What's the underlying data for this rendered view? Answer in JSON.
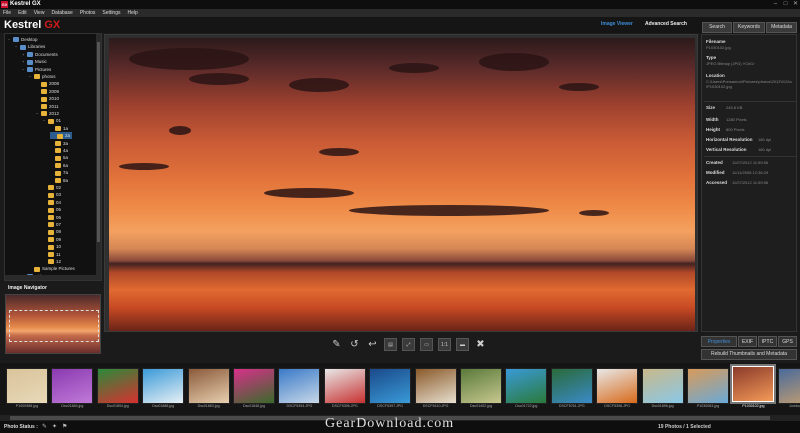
{
  "window": {
    "title": "Kestrel GX",
    "icon": "GX",
    "minimize": "–",
    "maximize": "□",
    "close": "✕"
  },
  "menu": [
    "File",
    "Edit",
    "View",
    "Database",
    "Photos",
    "Settings",
    "Help"
  ],
  "logo": {
    "main": "Kestrel",
    "accent": "GX"
  },
  "view_tabs": {
    "image_viewer": "Image Viewer",
    "advanced_search": "Advanced Search"
  },
  "panel_tabs": [
    "Search",
    "Keywords",
    "Metadata"
  ],
  "tree": [
    {
      "label": "Desktop",
      "level": 0,
      "exp": "−",
      "blue": true
    },
    {
      "label": "Libraries",
      "level": 1,
      "exp": "−",
      "blue": true
    },
    {
      "label": "Documents",
      "level": 2,
      "exp": "+",
      "blue": true
    },
    {
      "label": "Music",
      "level": 2,
      "exp": "+",
      "blue": true
    },
    {
      "label": "Pictures",
      "level": 2,
      "exp": "−",
      "blue": true
    },
    {
      "label": "photos",
      "level": 3,
      "exp": "−"
    },
    {
      "label": "2008",
      "level": 4,
      "exp": ""
    },
    {
      "label": "2009",
      "level": 4,
      "exp": ""
    },
    {
      "label": "2010",
      "level": 4,
      "exp": ""
    },
    {
      "label": "2011",
      "level": 4,
      "exp": ""
    },
    {
      "label": "2012",
      "level": 4,
      "exp": "−"
    },
    {
      "label": "01",
      "level": 5,
      "exp": "−"
    },
    {
      "label": "1a",
      "level": 6,
      "exp": ""
    },
    {
      "label": "2a",
      "level": 6,
      "exp": "",
      "selected": true
    },
    {
      "label": "3a",
      "level": 6,
      "exp": ""
    },
    {
      "label": "4a",
      "level": 6,
      "exp": ""
    },
    {
      "label": "5a",
      "level": 6,
      "exp": ""
    },
    {
      "label": "6a",
      "level": 6,
      "exp": ""
    },
    {
      "label": "7a",
      "level": 6,
      "exp": ""
    },
    {
      "label": "8a",
      "level": 6,
      "exp": ""
    },
    {
      "label": "02",
      "level": 5,
      "exp": ""
    },
    {
      "label": "03",
      "level": 5,
      "exp": ""
    },
    {
      "label": "04",
      "level": 5,
      "exp": ""
    },
    {
      "label": "05",
      "level": 5,
      "exp": ""
    },
    {
      "label": "06",
      "level": 5,
      "exp": ""
    },
    {
      "label": "07",
      "level": 5,
      "exp": ""
    },
    {
      "label": "08",
      "level": 5,
      "exp": ""
    },
    {
      "label": "09",
      "level": 5,
      "exp": ""
    },
    {
      "label": "10",
      "level": 5,
      "exp": ""
    },
    {
      "label": "11",
      "level": 5,
      "exp": ""
    },
    {
      "label": "12",
      "level": 5,
      "exp": ""
    },
    {
      "label": "Sample Pictures",
      "level": 3,
      "exp": ""
    },
    {
      "label": "Videos",
      "level": 2,
      "exp": "+",
      "blue": true
    }
  ],
  "navigator": {
    "label": "Image Navigator"
  },
  "toolbar": [
    {
      "name": "pencil-icon",
      "glyph": "✎"
    },
    {
      "name": "rotate-left-icon",
      "glyph": "↺"
    },
    {
      "name": "undo-icon",
      "glyph": "↩"
    },
    {
      "name": "film-icon",
      "glyph": "▤"
    },
    {
      "name": "fit-window-icon",
      "glyph": "⤢"
    },
    {
      "name": "monitor-icon",
      "glyph": "▭"
    },
    {
      "name": "actual-size-icon",
      "glyph": "1:1"
    },
    {
      "name": "fullscreen-icon",
      "glyph": "▬"
    },
    {
      "name": "delete-icon",
      "glyph": "✖"
    }
  ],
  "properties": {
    "filename_label": "Filename",
    "filename": "P1030102.jpg",
    "type_label": "Type",
    "type": "JPEG Bitmap (JPG) YCbCr",
    "location_label": "Location",
    "location": "C:\\Users\\Ponsamon\\Pictures\\photos\\2012\\01\\2a\\P1030102.jpg",
    "size_label": "Size",
    "size": "245.6 KB",
    "width_label": "Width",
    "width": "1280 Pixels",
    "height_label": "Height",
    "height": "800 Pixels",
    "hres_label": "Horizontal Resolution",
    "hres": "180 dpi",
    "vres_label": "Vertical Resolution",
    "vres": "180 dpi",
    "created_label": "Created",
    "created": "11/07/2012 11:59:56",
    "modified_label": "Modified",
    "modified": "11/11/2008 12:36:29",
    "accessed_label": "Accessed",
    "accessed": "11/07/2012 11:59:56"
  },
  "bottom_tabs": [
    "Properties",
    "EXIF",
    "IPTC",
    "GPS"
  ],
  "rebuild_label": "Rebuild Thumbnails and Metadata",
  "thumbnails": [
    {
      "label": "P1000988.jpg",
      "colors": [
        "#d9c39a",
        "#e8d9b8"
      ]
    },
    {
      "label": "Dsc01884.jpg",
      "colors": [
        "#8a3ab0",
        "#c07ad8"
      ]
    },
    {
      "label": "Dsc01894.jpg",
      "colors": [
        "#2a8a3a",
        "#d83030"
      ]
    },
    {
      "label": "Dsc01888.jpg",
      "colors": [
        "#3a9ad8",
        "#e8f0f4"
      ]
    },
    {
      "label": "Dsc01863.jpg",
      "colors": [
        "#8a5a3a",
        "#e8d0b0"
      ]
    },
    {
      "label": "Dsc01848.jpg",
      "colors": [
        "#d8308a",
        "#3a6a2a"
      ]
    },
    {
      "label": "DSCF5394.JPG",
      "colors": [
        "#3a7ac8",
        "#c8d8e8"
      ]
    },
    {
      "label": "DSCF5396.JPG",
      "colors": [
        "#e8e8e8",
        "#c83030"
      ]
    },
    {
      "label": "DSCF5397.JPG",
      "colors": [
        "#1a4a8a",
        "#3a9ad8"
      ]
    },
    {
      "label": "DSCF5410.JPG",
      "colors": [
        "#8a5a2a",
        "#e8e0d0"
      ]
    },
    {
      "label": "Dsc01452.jpg",
      "colors": [
        "#5a7a3a",
        "#c8c890"
      ]
    },
    {
      "label": "Dsc01722.jpg",
      "colors": [
        "#3a9ad8",
        "#2a7a3a"
      ]
    },
    {
      "label": "DSCF5761.JPG",
      "colors": [
        "#2a6a3a",
        "#3a8ac8"
      ]
    },
    {
      "label": "DSCF5398.JPG",
      "colors": [
        "#e8e8e8",
        "#d86a1a"
      ]
    },
    {
      "label": "Dsc01896.jpg",
      "colors": [
        "#c8b88a",
        "#8ac8e8"
      ]
    },
    {
      "label": "P1030083.jpg",
      "colors": [
        "#d89a5a",
        "#6aaad8"
      ]
    },
    {
      "label": "P1030102.jpg",
      "colors": [
        "#8a3a2a",
        "#f49a58"
      ],
      "selected": true
    },
    {
      "label": "Jumbo_10...",
      "colors": [
        "#4a6a9a",
        "#c8a070"
      ]
    }
  ],
  "status": {
    "label": "Photo Status :",
    "count": "19 Photos / 1 Selected",
    "watermark": "GearDownload.com"
  }
}
